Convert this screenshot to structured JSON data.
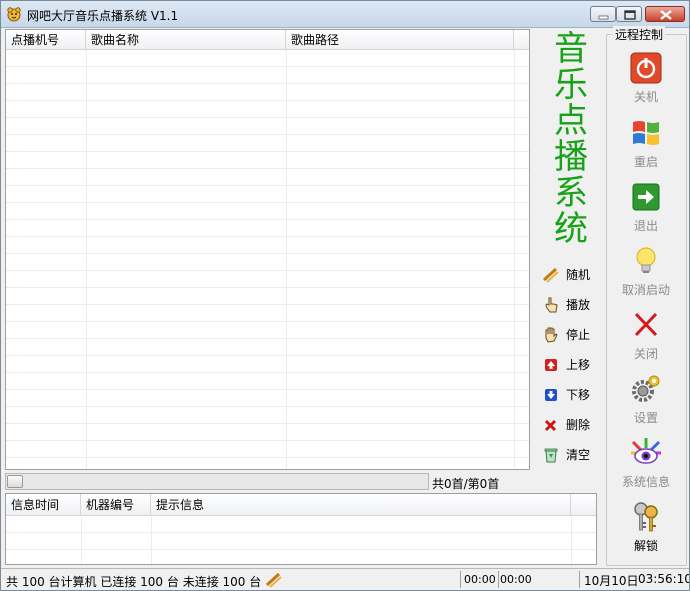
{
  "window": {
    "title": "网吧大厅音乐点播系统 V1.1"
  },
  "song_table": {
    "columns": [
      "点播机号",
      "歌曲名称",
      "歌曲路径"
    ]
  },
  "big_title": [
    "音",
    "乐",
    "点",
    "播",
    "系",
    "统"
  ],
  "controls": {
    "random": "随机",
    "play": "播放",
    "stop": "停止",
    "up": "上移",
    "down": "下移",
    "delete": "删除",
    "clear": "清空"
  },
  "song_count": "共0首/第0首",
  "info_table": {
    "columns": [
      "信息时间",
      "机器编号",
      "提示信息"
    ]
  },
  "remote": {
    "title": "远程控制",
    "shutdown": "关机",
    "restart": "重启",
    "logout": "退出",
    "cancel_start": "取消启动",
    "close": "关闭",
    "settings": "设置",
    "sysinfo": "系统信息",
    "unlock": "解锁"
  },
  "status": {
    "summary": "共 100 台计算机 已连接 100 台 未连接 100 台",
    "time1": "00:00",
    "time2": "00:00",
    "date": "10月10日",
    "clock": "03:56:10"
  },
  "colors": {
    "title_green": "#17a217",
    "disabled_text": "#8c8c8c"
  }
}
